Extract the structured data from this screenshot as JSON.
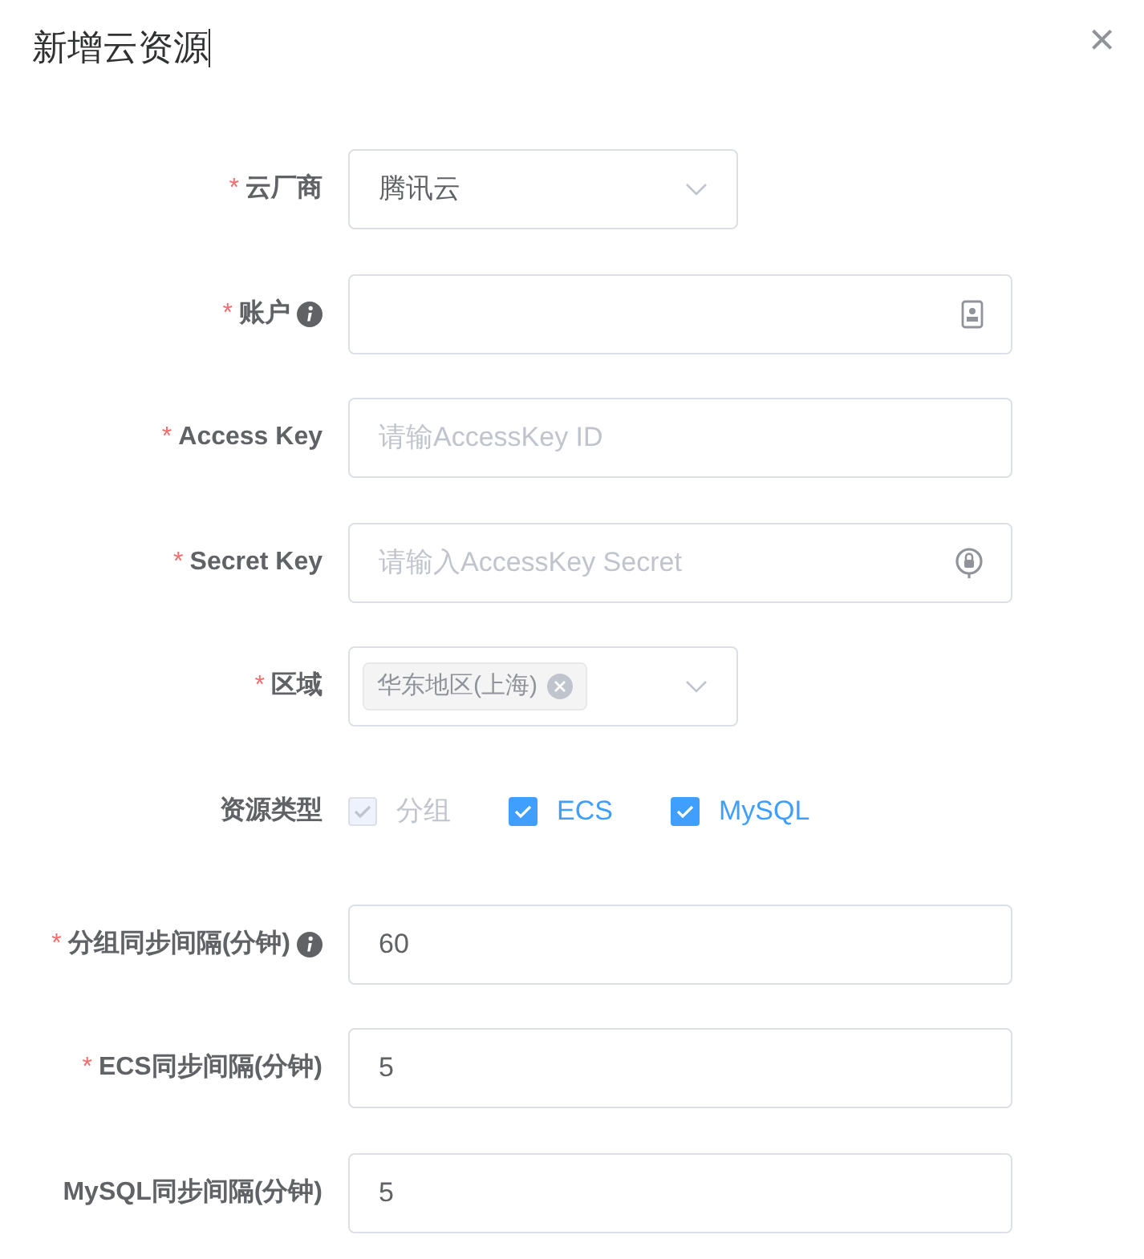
{
  "dialog": {
    "title": "新增云资源",
    "close": "×"
  },
  "fields": [
    {
      "kind": "select",
      "label": "云厂商",
      "required_mark": "*",
      "value": "腾讯云"
    },
    {
      "kind": "input",
      "label": "账户",
      "required_mark": "*",
      "info": true,
      "suffix": true
    },
    {
      "kind": "input",
      "label": "Access Key",
      "required_mark": "*",
      "placeholder": "请输AccessKey ID"
    },
    {
      "kind": "input",
      "label": "Secret Key",
      "required_mark": "*",
      "placeholder": "请输入AccessKey Secret",
      "suffix": true
    },
    {
      "kind": "tags",
      "label": "区域",
      "required_mark": "*",
      "tags": [
        "华东地区(上海)"
      ]
    },
    {
      "kind": "checkboxes",
      "label": "资源类型",
      "options": [
        {
          "label": "分组",
          "checked": true,
          "disabled": true
        },
        {
          "label": "ECS",
          "checked": true,
          "disabled": false
        },
        {
          "label": "MySQL",
          "checked": true,
          "disabled": false
        }
      ]
    },
    {
      "kind": "input",
      "label": "分组同步间隔(分钟)",
      "required_mark": "*",
      "info": true,
      "value": "60"
    },
    {
      "kind": "input",
      "label": "ECS同步间隔(分钟)",
      "required_mark": "*",
      "value": "5"
    },
    {
      "kind": "input",
      "label": "MySQL同步间隔(分钟)",
      "value": "5"
    }
  ]
}
